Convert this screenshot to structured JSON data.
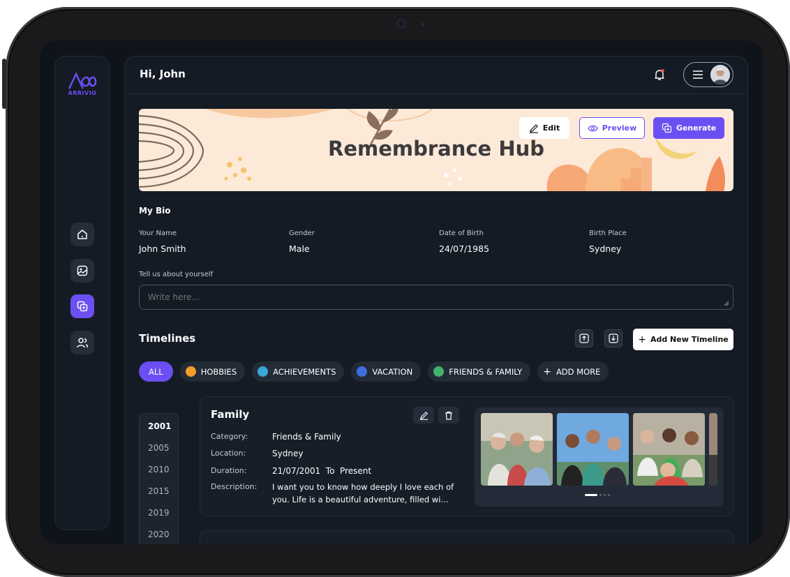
{
  "app": {
    "logo_text": "ARRIVIO",
    "accent": "#6b4ff2"
  },
  "header": {
    "greeting": "Hi, John"
  },
  "sidebar": {
    "items": [
      {
        "icon": "home-icon"
      },
      {
        "icon": "gallery-icon"
      },
      {
        "icon": "copy-add-icon",
        "active": true
      },
      {
        "icon": "users-icon"
      }
    ]
  },
  "banner": {
    "title": "Remembrance Hub",
    "edit_label": "Edit",
    "preview_label": "Preview",
    "generate_label": "Generate"
  },
  "bio": {
    "heading": "My Bio",
    "fields": [
      {
        "label": "Your Name",
        "value": "John Smith"
      },
      {
        "label": "Gender",
        "value": "Male"
      },
      {
        "label": "Date of Birth",
        "value": "24/07/1985"
      },
      {
        "label": "Birth Place",
        "value": "Sydney"
      }
    ],
    "about_label": "Tell us about yourself",
    "about_placeholder": "Write here..."
  },
  "timelines": {
    "heading": "Timelines",
    "add_label": "Add New Timeline",
    "chips": [
      "ALL",
      "HOBBIES",
      "ACHIEVEMENTS",
      "VACATION",
      "FRIENDS & FAMILY",
      "ADD MORE"
    ],
    "years": [
      "2001",
      "2005",
      "2010",
      "2015",
      "2019",
      "2020"
    ],
    "card": {
      "title": "Family",
      "category_label": "Category:",
      "category": "Friends & Family",
      "location_label": "Location:",
      "location": "Sydney",
      "duration_label": "Duration:",
      "duration": "21/07/2001  To  Present",
      "description_label": "Description:",
      "description": "I want you to know how deeply I love each of you. Life is a beautiful adventure, filled wi..."
    }
  }
}
